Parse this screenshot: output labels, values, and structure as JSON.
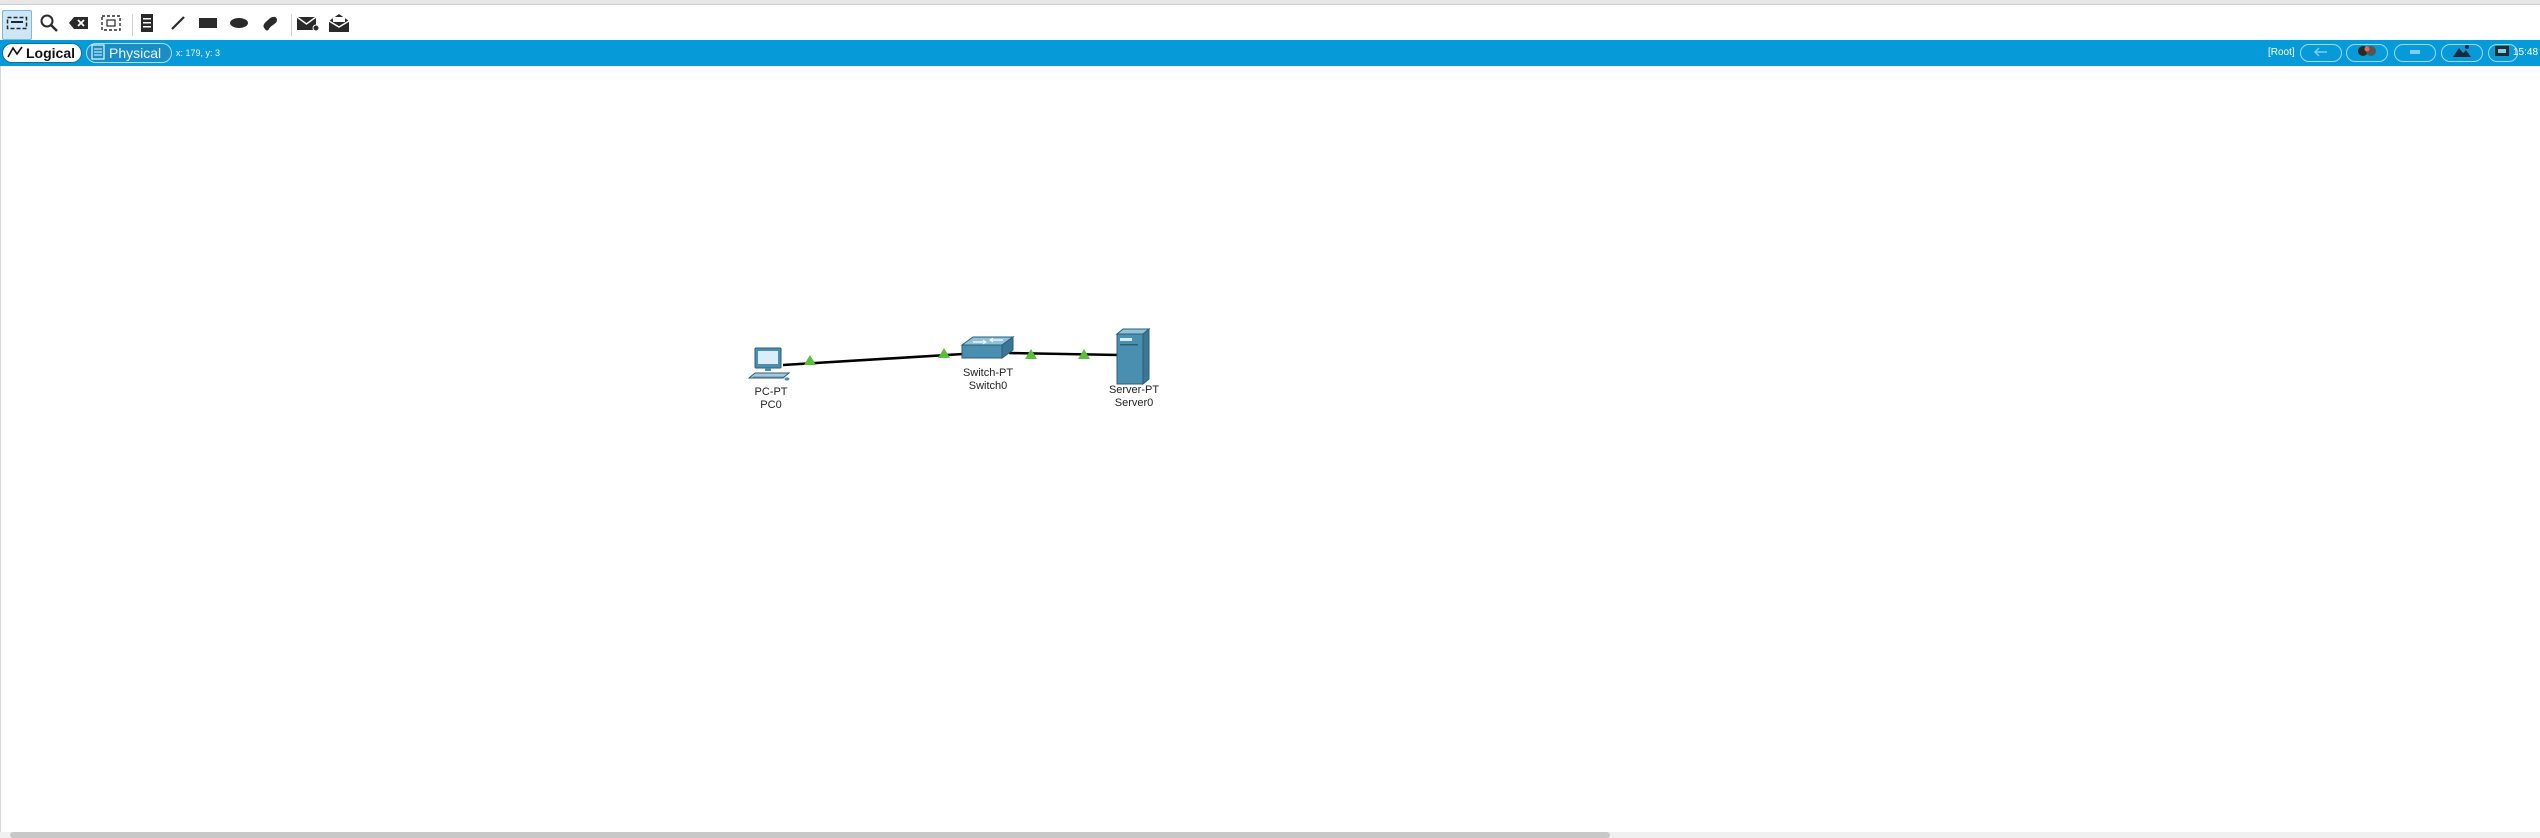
{
  "toolbar": {
    "tools": [
      {
        "id": "select",
        "icon": "select-marquee-icon",
        "active": true
      },
      {
        "id": "inspect",
        "icon": "magnifier-icon",
        "active": false
      },
      {
        "id": "delete",
        "icon": "delete-icon",
        "active": false
      },
      {
        "id": "resize",
        "icon": "resize-shape-icon",
        "active": false
      },
      {
        "id": "note",
        "icon": "note-icon",
        "active": false
      },
      {
        "id": "draw-line",
        "icon": "line-draw-icon",
        "active": false
      },
      {
        "id": "draw-rectangle",
        "icon": "rectangle-icon",
        "active": false
      },
      {
        "id": "draw-ellipse",
        "icon": "ellipse-icon",
        "active": false
      },
      {
        "id": "freeform",
        "icon": "freeform-icon",
        "active": false
      },
      {
        "id": "simple-pdu",
        "icon": "simple-pdu-envelope-icon",
        "active": false
      },
      {
        "id": "complex-pdu",
        "icon": "complex-pdu-envelope-icon",
        "active": false
      }
    ]
  },
  "workspace_bar": {
    "tabs": [
      {
        "label": "Logical",
        "active": true
      },
      {
        "label": "Physical",
        "active": false
      }
    ],
    "coords_text": "x: 179, y: 3",
    "root_label": "[Root]",
    "clock_text": "15:48",
    "colors": {
      "bar": "#079ad8",
      "tab_active_bg": "#ffffff"
    }
  },
  "topology": {
    "devices": [
      {
        "id": "PC0",
        "model": "PC-PT",
        "name": "PC0",
        "icon": "pc-icon"
      },
      {
        "id": "Switch0",
        "model": "Switch-PT",
        "name": "Switch0",
        "icon": "switch-icon"
      },
      {
        "id": "Server0",
        "model": "Server-PT",
        "name": "Server0",
        "icon": "server-icon"
      }
    ],
    "links": [
      {
        "from": "PC0",
        "to": "Switch0",
        "status": "up",
        "color": "#000000"
      },
      {
        "from": "Switch0",
        "to": "Server0",
        "status": "up",
        "color": "#000000"
      }
    ],
    "link_status_color": "#5bbf3a"
  }
}
